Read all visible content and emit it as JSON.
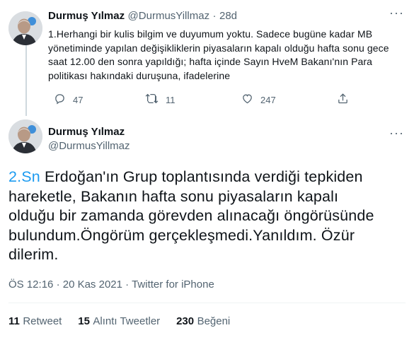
{
  "reply_tweet": {
    "author_name": "Durmuş Yılmaz",
    "author_handle": "@DurmusYillmaz",
    "separator": "·",
    "age": "28d",
    "lines": [
      "1.Herhangi bir kulis bilgim ve duyumum yoktu. Sadece bugüne kadar MB",
      "yönetiminde yapılan değişikliklerin piyasaların kapalı olduğu hafta sonu gece",
      "saat 12.00 den sonra yapıldığı; hafta içinde Sayın HveM Bakanı'nın Para",
      "politikası hakındaki duruşuna, ifadelerine"
    ],
    "reply_count": "47",
    "retweet_count": "11",
    "like_count": "247"
  },
  "main_tweet": {
    "author_name": "Durmuş Yılmaz",
    "author_handle": "@DurmusYillmaz",
    "mention": "2.Sn",
    "lines": [
      " Erdoğan'ın Grup toplantısında verdiği tepkiden",
      "hareketle,  Bakanın hafta sonu piyasaların kapalı",
      "olduğu bir zamanda görevden alınacağı öngörüsünde",
      "bulundum.Öngörüm gerçekleşmedi.Yanıldım. Özür",
      "dilerim."
    ],
    "time": "ÖS 12:16",
    "date": "20 Kas 2021",
    "meta_sep": "·",
    "source": "Twitter for iPhone",
    "stats": {
      "retweets_num": "11",
      "retweets_label": "Retweet",
      "quotes_num": "15",
      "quotes_label": "Alıntı Tweetler",
      "likes_num": "230",
      "likes_label": "Beğeni"
    }
  },
  "colors": {
    "accent": "#1d9bf0",
    "text": "#0f1419",
    "muted": "#536471",
    "divider": "#eff3f4"
  },
  "icons": [
    "avatar",
    "more-icon",
    "reply-icon",
    "retweet-icon",
    "like-icon",
    "share-icon"
  ]
}
